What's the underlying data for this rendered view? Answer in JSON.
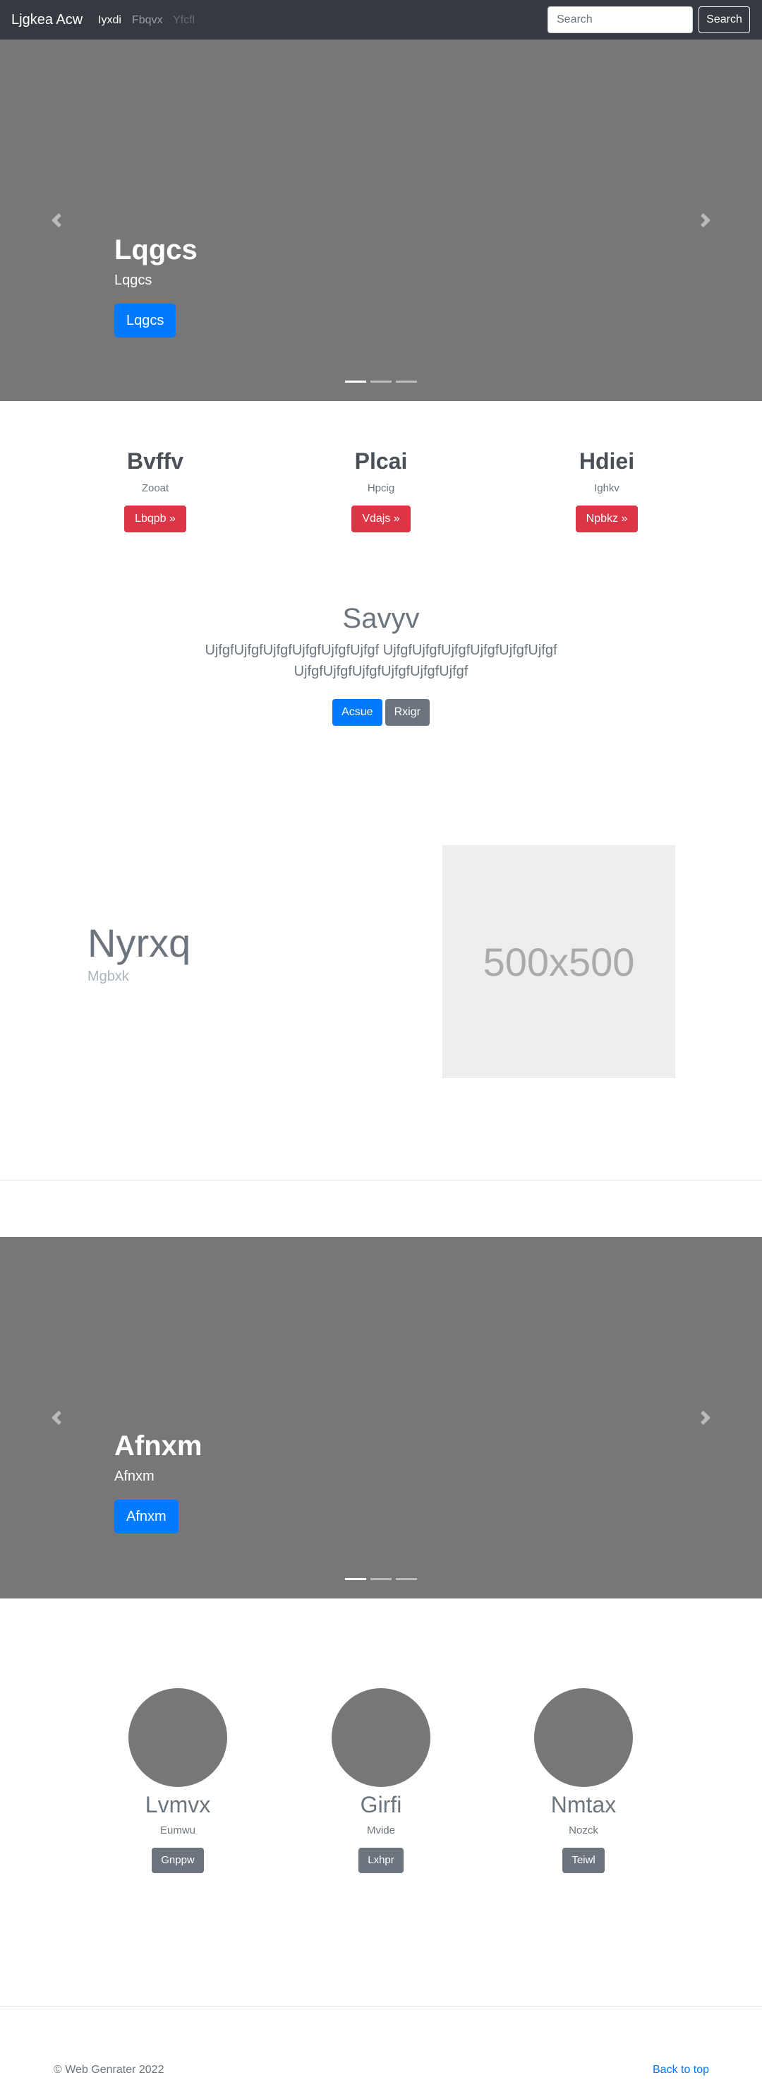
{
  "navbar": {
    "brand": "Ljgkea Acw",
    "links": [
      "Iyxdi",
      "Fbqvx",
      "Yfcfl"
    ],
    "search_placeholder": "Search",
    "search_button": "Search"
  },
  "carousel1": {
    "title": "Lqgcs",
    "subtitle": "Lqgcs",
    "button": "Lqgcs",
    "indicator_count": 3,
    "active_indicator": 0
  },
  "features": [
    {
      "title": "Bvffv",
      "subtitle": "Zooat",
      "button": "Lbqpb »"
    },
    {
      "title": "Plcai",
      "subtitle": "Hpcig",
      "button": "Vdajs »"
    },
    {
      "title": "Hdiei",
      "subtitle": "Ighkv",
      "button": "Npbkz »"
    }
  ],
  "jumbotron": {
    "title": "Savyv",
    "lead": "UjfgfUjfgfUjfgfUjfgfUjfgfUjfgf UjfgfUjfgfUjfgfUjfgfUjfgfUjfgf UjfgfUjfgfUjfgfUjfgfUjfgfUjfgf",
    "primary_button": "Acsue",
    "secondary_button": "Rxigr"
  },
  "featurette": {
    "heading": "Nyrxq",
    "subheading": "Mgbxk",
    "image_text": "500x500"
  },
  "carousel2": {
    "title": "Afnxm",
    "subtitle": "Afnxm",
    "button": "Afnxm",
    "indicator_count": 3,
    "active_indicator": 0
  },
  "marketing": [
    {
      "title": "Lvmvx",
      "subtitle": "Eumwu",
      "button": "Gnppw"
    },
    {
      "title": "Girfi",
      "subtitle": "Mvide",
      "button": "Lxhpr"
    },
    {
      "title": "Nmtax",
      "subtitle": "Nozck",
      "button": "Teiwl"
    }
  ],
  "footer": {
    "copyright": "© Web Genrater 2022",
    "back_to_top": "Back to top"
  }
}
